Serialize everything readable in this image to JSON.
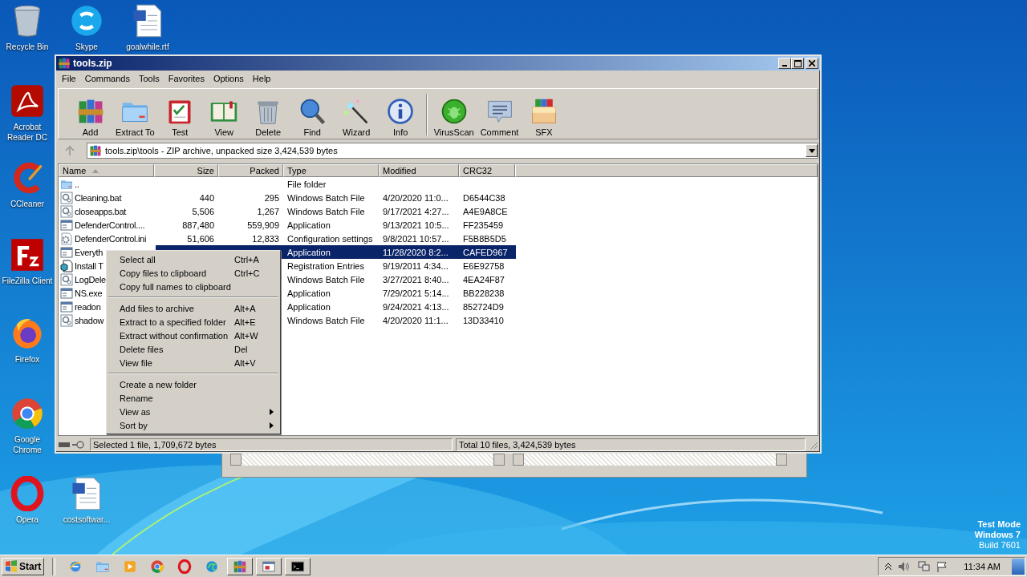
{
  "desktop": {
    "icons": [
      {
        "label": "Recycle Bin",
        "kind": "bin"
      },
      {
        "label": "Skype",
        "kind": "chat"
      },
      {
        "label": "goalwhile.rtf",
        "kind": "doc"
      },
      {
        "label": "Acrobat Reader DC",
        "kind": "pdf"
      },
      {
        "label": "CCleaner",
        "kind": "cleaner"
      },
      {
        "label": "FileZilla Client",
        "kind": "tile"
      },
      {
        "label": "Firefox",
        "kind": "orb"
      },
      {
        "label": "Google Chrome",
        "kind": "wheel"
      },
      {
        "label": "Opera",
        "kind": "ring"
      },
      {
        "label": "costsoftwar...",
        "kind": "doc"
      }
    ],
    "system_notice": [
      "Test Mode",
      "Windows 7",
      "Build 7601"
    ]
  },
  "window": {
    "title": "tools.zip",
    "menu": [
      "File",
      "Commands",
      "Tools",
      "Favorites",
      "Options",
      "Help"
    ],
    "toolbar": [
      {
        "label": "Add",
        "kind": "books",
        "separator_before": false
      },
      {
        "label": "Extract To",
        "kind": "folder",
        "separator_before": false
      },
      {
        "label": "Test",
        "kind": "clipboard",
        "separator_before": false
      },
      {
        "label": "View",
        "kind": "book",
        "separator_before": false
      },
      {
        "label": "Delete",
        "kind": "trash",
        "separator_before": false
      },
      {
        "label": "Find",
        "kind": "search",
        "separator_before": false
      },
      {
        "label": "Wizard",
        "kind": "wand",
        "separator_before": false
      },
      {
        "label": "Info",
        "kind": "info",
        "separator_before": false
      },
      {
        "label": "VirusScan",
        "kind": "bug",
        "separator_before": true
      },
      {
        "label": "Comment",
        "kind": "comment",
        "separator_before": false
      },
      {
        "label": "SFX",
        "kind": "box",
        "separator_before": false
      }
    ],
    "address": "tools.zip\\tools - ZIP archive, unpacked size 3,424,539 bytes",
    "columns": [
      "Name",
      "Size",
      "Packed",
      "Type",
      "Modified",
      "CRC32"
    ],
    "rows": [
      {
        "kind": "folder",
        "name": "..",
        "type": "File folder",
        "selected": false
      },
      {
        "kind": "script",
        "name": "Cleaning.bat",
        "size": "440",
        "packed": "295",
        "type": "Windows Batch File",
        "modified": "4/20/2020 11:0...",
        "crc": "D6544C38",
        "selected": false
      },
      {
        "kind": "script",
        "name": "closeapps.bat",
        "size": "5,506",
        "packed": "1,267",
        "type": "Windows Batch File",
        "modified": "9/17/2021 4:27...",
        "crc": "A4E9A8CE",
        "selected": false
      },
      {
        "kind": "app",
        "name": "DefenderControl....",
        "size": "887,480",
        "packed": "559,909",
        "type": "Application",
        "modified": "9/13/2021 10:5...",
        "crc": "FF235459",
        "selected": false
      },
      {
        "kind": "settings",
        "name": "DefenderControl.ini",
        "size": "51,606",
        "packed": "12,833",
        "type": "Configuration settings",
        "modified": "9/8/2021 10:57...",
        "crc": "F5B8B5D5",
        "selected": false
      },
      {
        "kind": "app",
        "name": "Everyth",
        "type": "Application",
        "modified": "11/28/2020 8:2...",
        "crc": "CAFED967",
        "selected": true
      },
      {
        "kind": "registry",
        "name": "Install T",
        "type": "Registration Entries",
        "modified": "9/19/2011 4:34...",
        "crc": "E6E92758",
        "selected": false
      },
      {
        "kind": "script",
        "name": "LogDele",
        "type": "Windows Batch File",
        "modified": "3/27/2021 8:40...",
        "crc": "4EA24F87",
        "selected": false
      },
      {
        "kind": "app",
        "name": "NS.exe",
        "type": "Application",
        "modified": "7/29/2021 5:14...",
        "crc": "BB228238",
        "selected": false
      },
      {
        "kind": "app",
        "name": "readon",
        "type": "Application",
        "modified": "9/24/2021 4:13...",
        "crc": "852724D9",
        "selected": false
      },
      {
        "kind": "script",
        "name": "shadow",
        "type": "Windows Batch File",
        "modified": "4/20/2020 11:1...",
        "crc": "13D33410",
        "selected": false
      }
    ],
    "context_menu": [
      [
        {
          "label": "Select all",
          "shortcut": "Ctrl+A",
          "submenu": false
        },
        {
          "label": "Copy files to clipboard",
          "shortcut": "Ctrl+C",
          "submenu": false
        },
        {
          "label": "Copy full names to clipboard",
          "submenu": false
        }
      ],
      [
        {
          "label": "Add files to archive",
          "shortcut": "Alt+A",
          "submenu": false
        },
        {
          "label": "Extract to a specified folder",
          "shortcut": "Alt+E",
          "submenu": false
        },
        {
          "label": "Extract without confirmation",
          "shortcut": "Alt+W",
          "submenu": false
        },
        {
          "label": "Delete files",
          "shortcut": "Del",
          "submenu": false
        },
        {
          "label": "View file",
          "shortcut": "Alt+V",
          "submenu": false
        }
      ],
      [
        {
          "label": "Create a new folder",
          "submenu": false
        },
        {
          "label": "Rename",
          "submenu": false
        },
        {
          "label": "View as",
          "submenu": true
        },
        {
          "label": "Sort by",
          "submenu": true
        }
      ]
    ],
    "status_bar": [
      "Selected 1 file, 1,709,672 bytes",
      "Total 10 files, 3,424,539 bytes"
    ]
  },
  "taskbar": {
    "start": "Start",
    "items": [
      {
        "kind": "globe",
        "running": false
      },
      {
        "kind": "folder",
        "running": false
      },
      {
        "kind": "play",
        "running": false
      },
      {
        "kind": "wheel",
        "running": false
      },
      {
        "kind": "ring",
        "running": false
      },
      {
        "kind": "swirl",
        "running": false
      },
      {
        "kind": "books",
        "running": true
      },
      {
        "kind": "window",
        "running": true
      },
      {
        "kind": "terminal",
        "running": true
      }
    ],
    "clock": "11:34 AM"
  }
}
